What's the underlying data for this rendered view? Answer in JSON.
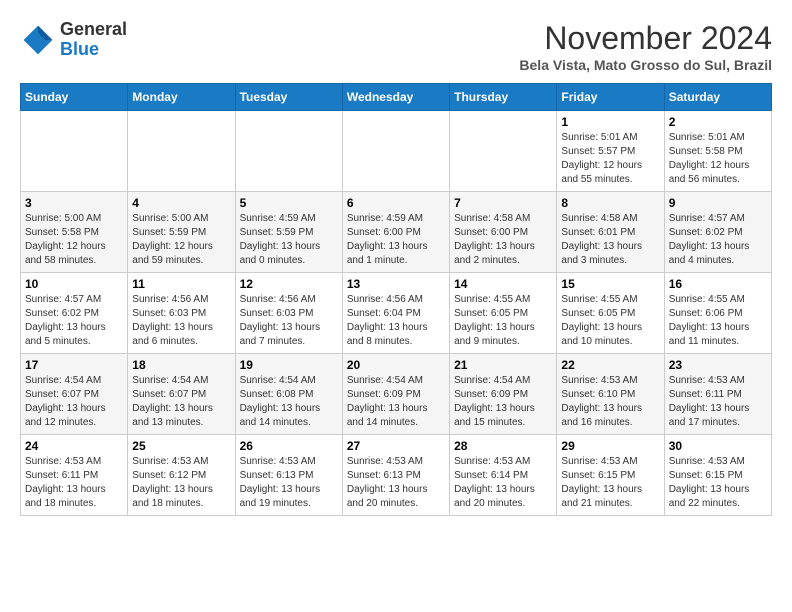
{
  "header": {
    "logo": {
      "general": "General",
      "blue": "Blue"
    },
    "title": "November 2024",
    "location": "Bela Vista, Mato Grosso do Sul, Brazil"
  },
  "days_of_week": [
    "Sunday",
    "Monday",
    "Tuesday",
    "Wednesday",
    "Thursday",
    "Friday",
    "Saturday"
  ],
  "weeks": [
    [
      {
        "day": "",
        "info": ""
      },
      {
        "day": "",
        "info": ""
      },
      {
        "day": "",
        "info": ""
      },
      {
        "day": "",
        "info": ""
      },
      {
        "day": "",
        "info": ""
      },
      {
        "day": "1",
        "info": "Sunrise: 5:01 AM\nSunset: 5:57 PM\nDaylight: 12 hours and 55 minutes."
      },
      {
        "day": "2",
        "info": "Sunrise: 5:01 AM\nSunset: 5:58 PM\nDaylight: 12 hours and 56 minutes."
      }
    ],
    [
      {
        "day": "3",
        "info": "Sunrise: 5:00 AM\nSunset: 5:58 PM\nDaylight: 12 hours and 58 minutes."
      },
      {
        "day": "4",
        "info": "Sunrise: 5:00 AM\nSunset: 5:59 PM\nDaylight: 12 hours and 59 minutes."
      },
      {
        "day": "5",
        "info": "Sunrise: 4:59 AM\nSunset: 5:59 PM\nDaylight: 13 hours and 0 minutes."
      },
      {
        "day": "6",
        "info": "Sunrise: 4:59 AM\nSunset: 6:00 PM\nDaylight: 13 hours and 1 minute."
      },
      {
        "day": "7",
        "info": "Sunrise: 4:58 AM\nSunset: 6:00 PM\nDaylight: 13 hours and 2 minutes."
      },
      {
        "day": "8",
        "info": "Sunrise: 4:58 AM\nSunset: 6:01 PM\nDaylight: 13 hours and 3 minutes."
      },
      {
        "day": "9",
        "info": "Sunrise: 4:57 AM\nSunset: 6:02 PM\nDaylight: 13 hours and 4 minutes."
      }
    ],
    [
      {
        "day": "10",
        "info": "Sunrise: 4:57 AM\nSunset: 6:02 PM\nDaylight: 13 hours and 5 minutes."
      },
      {
        "day": "11",
        "info": "Sunrise: 4:56 AM\nSunset: 6:03 PM\nDaylight: 13 hours and 6 minutes."
      },
      {
        "day": "12",
        "info": "Sunrise: 4:56 AM\nSunset: 6:03 PM\nDaylight: 13 hours and 7 minutes."
      },
      {
        "day": "13",
        "info": "Sunrise: 4:56 AM\nSunset: 6:04 PM\nDaylight: 13 hours and 8 minutes."
      },
      {
        "day": "14",
        "info": "Sunrise: 4:55 AM\nSunset: 6:05 PM\nDaylight: 13 hours and 9 minutes."
      },
      {
        "day": "15",
        "info": "Sunrise: 4:55 AM\nSunset: 6:05 PM\nDaylight: 13 hours and 10 minutes."
      },
      {
        "day": "16",
        "info": "Sunrise: 4:55 AM\nSunset: 6:06 PM\nDaylight: 13 hours and 11 minutes."
      }
    ],
    [
      {
        "day": "17",
        "info": "Sunrise: 4:54 AM\nSunset: 6:07 PM\nDaylight: 13 hours and 12 minutes."
      },
      {
        "day": "18",
        "info": "Sunrise: 4:54 AM\nSunset: 6:07 PM\nDaylight: 13 hours and 13 minutes."
      },
      {
        "day": "19",
        "info": "Sunrise: 4:54 AM\nSunset: 6:08 PM\nDaylight: 13 hours and 14 minutes."
      },
      {
        "day": "20",
        "info": "Sunrise: 4:54 AM\nSunset: 6:09 PM\nDaylight: 13 hours and 14 minutes."
      },
      {
        "day": "21",
        "info": "Sunrise: 4:54 AM\nSunset: 6:09 PM\nDaylight: 13 hours and 15 minutes."
      },
      {
        "day": "22",
        "info": "Sunrise: 4:53 AM\nSunset: 6:10 PM\nDaylight: 13 hours and 16 minutes."
      },
      {
        "day": "23",
        "info": "Sunrise: 4:53 AM\nSunset: 6:11 PM\nDaylight: 13 hours and 17 minutes."
      }
    ],
    [
      {
        "day": "24",
        "info": "Sunrise: 4:53 AM\nSunset: 6:11 PM\nDaylight: 13 hours and 18 minutes."
      },
      {
        "day": "25",
        "info": "Sunrise: 4:53 AM\nSunset: 6:12 PM\nDaylight: 13 hours and 18 minutes."
      },
      {
        "day": "26",
        "info": "Sunrise: 4:53 AM\nSunset: 6:13 PM\nDaylight: 13 hours and 19 minutes."
      },
      {
        "day": "27",
        "info": "Sunrise: 4:53 AM\nSunset: 6:13 PM\nDaylight: 13 hours and 20 minutes."
      },
      {
        "day": "28",
        "info": "Sunrise: 4:53 AM\nSunset: 6:14 PM\nDaylight: 13 hours and 20 minutes."
      },
      {
        "day": "29",
        "info": "Sunrise: 4:53 AM\nSunset: 6:15 PM\nDaylight: 13 hours and 21 minutes."
      },
      {
        "day": "30",
        "info": "Sunrise: 4:53 AM\nSunset: 6:15 PM\nDaylight: 13 hours and 22 minutes."
      }
    ]
  ]
}
